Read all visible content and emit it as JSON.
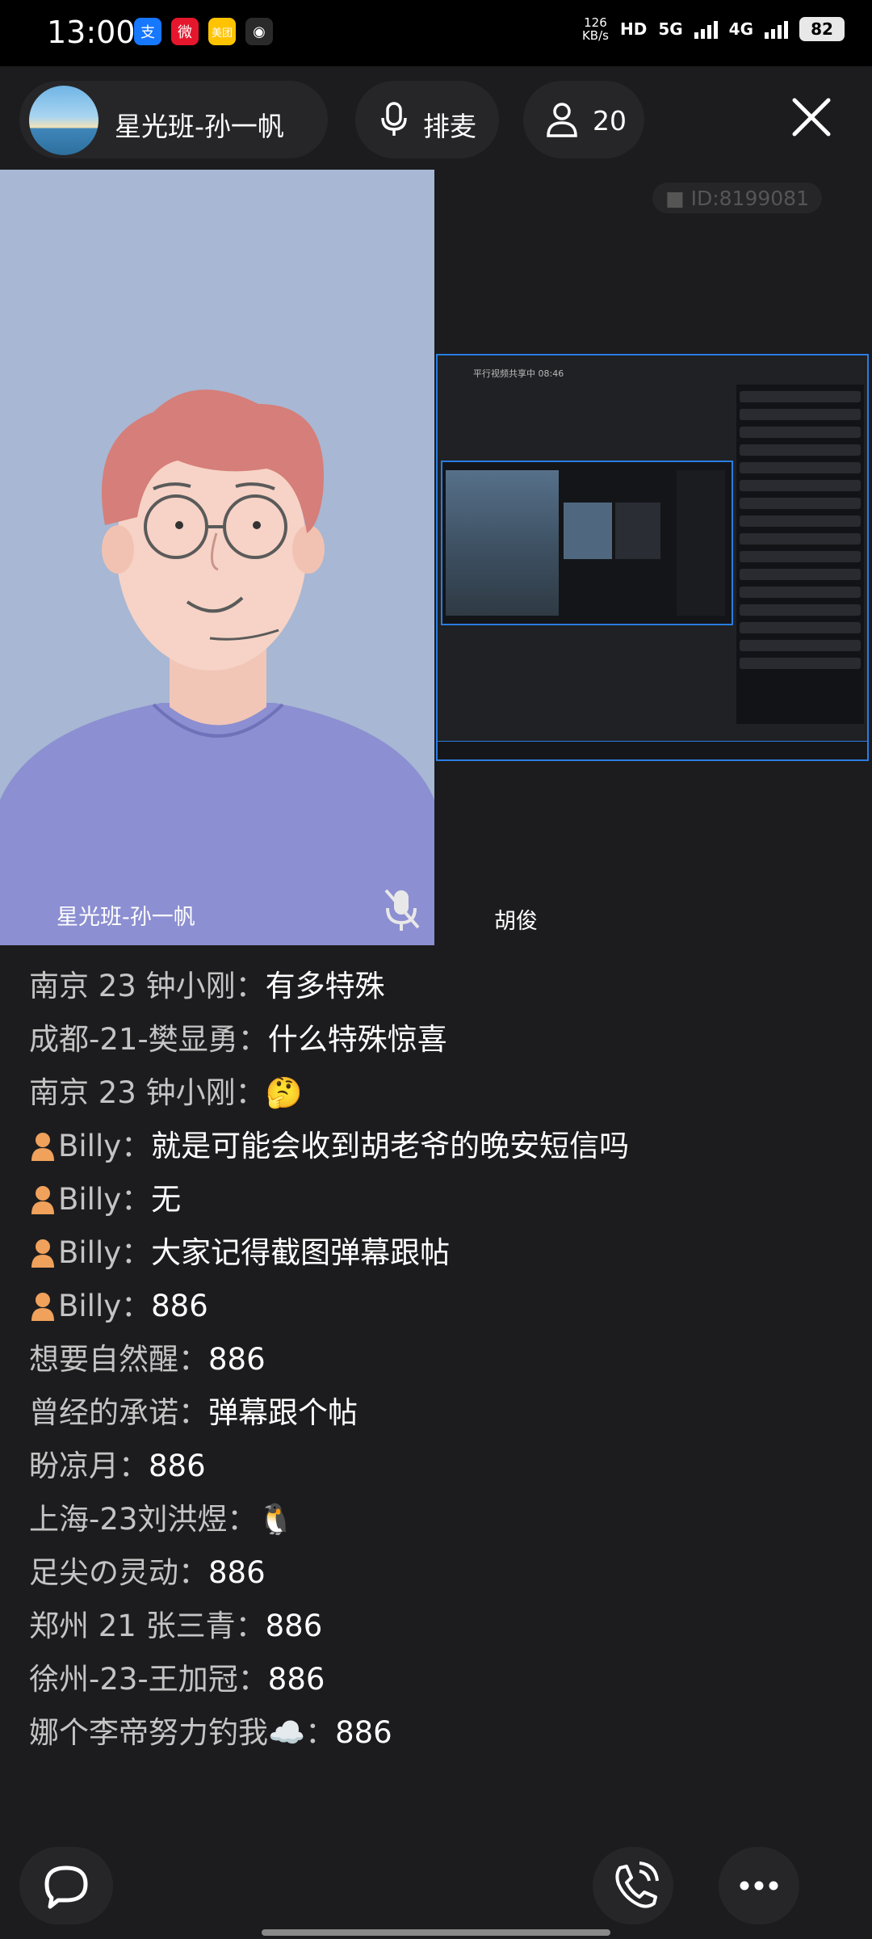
{
  "status_bar": {
    "time": "13:00",
    "apps": [
      {
        "icon": "alipay-icon",
        "glyph": "支",
        "color": "#1677ff"
      },
      {
        "icon": "weibo-icon",
        "glyph": "微",
        "color": "#e6162d"
      },
      {
        "icon": "meituan-icon",
        "glyph": "美团",
        "color": "#ffc300"
      },
      {
        "icon": "wifi-status-icon",
        "glyph": "◉",
        "color": "#2a2a2a"
      }
    ],
    "speed_value": "126",
    "speed_unit": "KB/s",
    "hd_label": "HD",
    "net1": "5G",
    "net2": "4G",
    "battery": "82"
  },
  "header": {
    "host_name": "星光班-孙一帆",
    "mic_label": "排麦",
    "user_count": "20"
  },
  "video": {
    "room_id": "ID:8199081",
    "left_name": "星光班-孙一帆",
    "right_name": "胡俊",
    "share_title": "平行视频共享中 08:46"
  },
  "comments": [
    {
      "user": "南京 23 钟小刚：",
      "text": "有多特殊",
      "face": false
    },
    {
      "user": "成都-21-樊显勇：",
      "text": "什么特殊惊喜",
      "face": false
    },
    {
      "user": "南京 23 钟小刚：",
      "text": "🤔",
      "face": false
    },
    {
      "user": "Billy：",
      "text": "就是可能会收到胡老爷的晚安短信吗",
      "face": true
    },
    {
      "user": "Billy：",
      "text": "无",
      "face": true
    },
    {
      "user": "Billy：",
      "text": "大家记得截图弹幕跟帖",
      "face": true
    },
    {
      "user": "Billy：",
      "text": "886",
      "face": true
    },
    {
      "user": "想要自然醒：",
      "text": "886",
      "face": false
    },
    {
      "user": "曾经的承诺：",
      "text": "弹幕跟个帖",
      "face": false
    },
    {
      "user": "盼凉月：",
      "text": "886",
      "face": false
    },
    {
      "user": "上海-23刘洪煜：",
      "text": "🐧",
      "face": false
    },
    {
      "user": "足尖の灵动：",
      "text": "886",
      "face": false
    },
    {
      "user": "郑州 21  张三青：",
      "text": "886",
      "face": false
    },
    {
      "user": "徐州-23-王加冠：",
      "text": "886",
      "face": false
    },
    {
      "user": "娜个李帝努力钓我☁️：",
      "text": "886",
      "face": false
    }
  ]
}
